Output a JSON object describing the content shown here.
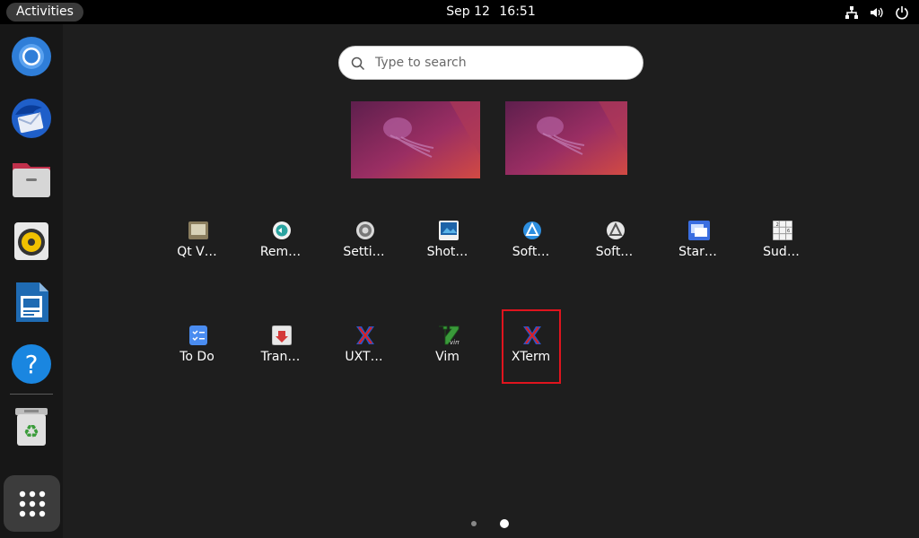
{
  "topbar": {
    "activities_label": "Activities",
    "date": "Sep 12",
    "time": "16:51",
    "tray_icons": [
      "network-icon",
      "volume-icon",
      "power-icon"
    ]
  },
  "dock": {
    "items": [
      {
        "name": "chromium-icon"
      },
      {
        "name": "thunderbird-icon"
      },
      {
        "name": "files-icon"
      },
      {
        "name": "rhythmbox-icon"
      },
      {
        "name": "libreoffice-impress-icon"
      },
      {
        "name": "help-icon"
      },
      {
        "name": "trash-icon"
      }
    ],
    "apps_button_icon": "app-grid-icon"
  },
  "search": {
    "placeholder": "Type to search"
  },
  "apps": [
    {
      "label": "Qt V…",
      "icon": "qt-v-icon"
    },
    {
      "label": "Rem…",
      "icon": "remmina-icon"
    },
    {
      "label": "Setti…",
      "icon": "settings-icon"
    },
    {
      "label": "Shot…",
      "icon": "shotwell-icon"
    },
    {
      "label": "Soft…",
      "icon": "software-icon"
    },
    {
      "label": "Soft…",
      "icon": "software-updater-icon"
    },
    {
      "label": "Star…",
      "icon": "startup-icon"
    },
    {
      "label": "Sud…",
      "icon": "sudoku-icon"
    },
    {
      "label": "To Do",
      "icon": "todo-icon"
    },
    {
      "label": "Tran…",
      "icon": "transmission-icon"
    },
    {
      "label": "UXT…",
      "icon": "uxterm-icon"
    },
    {
      "label": "Vim",
      "icon": "vim-icon"
    },
    {
      "label": "XTerm",
      "icon": "xterm-icon"
    }
  ],
  "pager": {
    "pages": 2,
    "current": 2
  },
  "colors": {
    "accent_selection": "#e0141e",
    "wallpaper": "#8b2a62"
  }
}
